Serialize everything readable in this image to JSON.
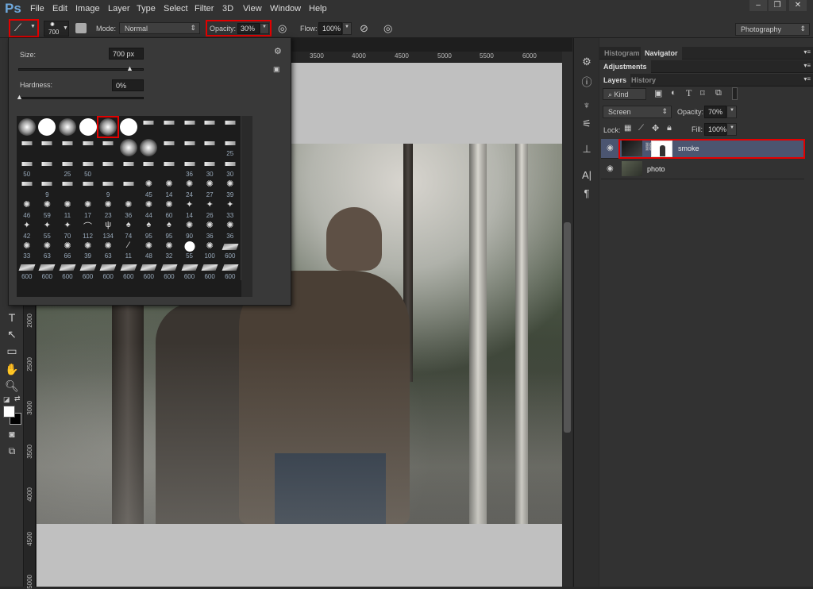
{
  "app": {
    "logo": "Ps"
  },
  "menu": [
    "File",
    "Edit",
    "Image",
    "Layer",
    "Type",
    "Select",
    "Filter",
    "3D",
    "View",
    "Window",
    "Help"
  ],
  "window_controls": [
    "–",
    "❐",
    "✕"
  ],
  "options": {
    "brush_size": "700",
    "mode_label": "Mode:",
    "mode": "Normal",
    "opacity_label": "Opacity:",
    "opacity": "30%",
    "flow_label": "Flow:",
    "flow": "100%",
    "workspace": "Photography"
  },
  "brush_panel": {
    "size_label": "Size:",
    "size": "700 px",
    "size_value": 700,
    "hardness_label": "Hardness:",
    "hardness": "0%",
    "hardness_value": 0,
    "grid": [
      [
        [
          "soft",
          ""
        ],
        [
          "hard",
          ""
        ],
        [
          "soft",
          ""
        ],
        [
          "hard",
          ""
        ],
        [
          "soft-selected",
          ""
        ],
        [
          "hard",
          ""
        ],
        [
          "tip",
          ""
        ],
        [
          "tip",
          ""
        ],
        [
          "tip",
          ""
        ],
        [
          "tip",
          ""
        ],
        [
          "tip",
          ""
        ]
      ],
      [
        [
          "tip",
          ""
        ],
        [
          "tip",
          ""
        ],
        [
          "tip",
          ""
        ],
        [
          "tip",
          ""
        ],
        [
          "tip",
          ""
        ],
        [
          "soft",
          ""
        ],
        [
          "soft",
          ""
        ],
        [
          "tip",
          ""
        ],
        [
          "tip",
          ""
        ],
        [
          "tip",
          ""
        ],
        [
          "tip",
          "25"
        ]
      ],
      [
        [
          "tip",
          "50"
        ],
        [
          "tip",
          ""
        ],
        [
          "tip",
          "25"
        ],
        [
          "tip",
          "50"
        ],
        [
          "tip",
          ""
        ],
        [
          "tip",
          ""
        ],
        [
          "tip",
          ""
        ],
        [
          "tip",
          ""
        ],
        [
          "tip",
          "36"
        ],
        [
          "tip",
          "30"
        ],
        [
          "tip",
          "30"
        ]
      ],
      [
        [
          "tip",
          ""
        ],
        [
          "tip",
          "9"
        ],
        [
          "tip",
          ""
        ],
        [
          "tip",
          ""
        ],
        [
          "tip",
          "9"
        ],
        [
          "tip",
          ""
        ],
        [
          "splat",
          "45"
        ],
        [
          "splat",
          "14"
        ],
        [
          "splat",
          "24"
        ],
        [
          "splat",
          "27"
        ],
        [
          "splat",
          "39"
        ]
      ],
      [
        [
          "splat",
          "46"
        ],
        [
          "splat",
          "59"
        ],
        [
          "splat",
          "11"
        ],
        [
          "splat",
          "17"
        ],
        [
          "splat",
          "23"
        ],
        [
          "splat",
          "36"
        ],
        [
          "splat",
          "44"
        ],
        [
          "splat",
          "60"
        ],
        [
          "star",
          "14"
        ],
        [
          "star",
          "26"
        ],
        [
          "star",
          "33"
        ]
      ],
      [
        [
          "star",
          "42"
        ],
        [
          "star",
          "55"
        ],
        [
          "star",
          "70"
        ],
        [
          "curve",
          "112"
        ],
        [
          "grass",
          "134"
        ],
        [
          "leaf",
          "74"
        ],
        [
          "leaf",
          "95"
        ],
        [
          "leaf",
          "95"
        ],
        [
          "splat",
          "90"
        ],
        [
          "splat",
          "36"
        ],
        [
          "splat",
          "36"
        ]
      ],
      [
        [
          "splat",
          "33"
        ],
        [
          "splat",
          "63"
        ],
        [
          "splat",
          "66"
        ],
        [
          "splat",
          "39"
        ],
        [
          "splat",
          "63"
        ],
        [
          "dash",
          "11"
        ],
        [
          "splat",
          "48"
        ],
        [
          "splat",
          "32"
        ],
        [
          "hard-small",
          "55"
        ],
        [
          "splat",
          "100"
        ],
        [
          "texture",
          "600"
        ]
      ],
      [
        [
          "texture",
          "600"
        ],
        [
          "texture",
          "600"
        ],
        [
          "texture",
          "600"
        ],
        [
          "texture",
          "600"
        ],
        [
          "texture",
          "600"
        ],
        [
          "texture",
          "600"
        ],
        [
          "texture",
          "600"
        ],
        [
          "texture",
          "600"
        ],
        [
          "texture",
          "600"
        ],
        [
          "texture",
          "600"
        ],
        [
          "texture",
          "600"
        ]
      ]
    ]
  },
  "rulers": {
    "h": [
      "3500",
      "4000",
      "4500",
      "5000",
      "5500",
      "6000"
    ],
    "v": [
      "2000",
      "2500",
      "3000",
      "3500",
      "4000",
      "4500",
      "5000"
    ]
  },
  "panels": {
    "tabs1": [
      "Histogram",
      "Navigator"
    ],
    "tabs2": [
      "Adjustments"
    ],
    "tabs3": [
      "Layers",
      "History"
    ]
  },
  "layers": {
    "filter": "Kind",
    "blend": "Screen",
    "opacity_label": "Opacity:",
    "opacity": "70%",
    "lock_label": "Lock:",
    "fill_label": "Fill:",
    "fill": "100%",
    "items": [
      {
        "name": "smoke",
        "selected": true
      },
      {
        "name": "photo",
        "selected": false
      }
    ]
  },
  "colors": {
    "highlight": "#e30000",
    "selected_layer": "#4b5570"
  }
}
